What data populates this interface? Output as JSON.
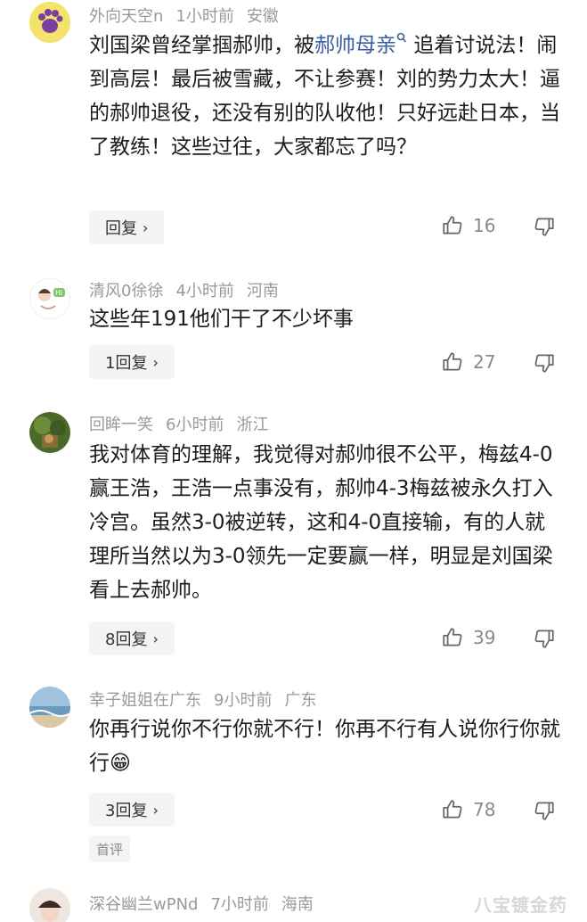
{
  "comments": [
    {
      "username": "外向天空n",
      "time": "1小时前",
      "location": "安徽",
      "text_before": "刘国梁曾经掌掴郝帅，被",
      "tag": "郝帅母亲",
      "text_after": "追着讨说法！闹到高层！最后被雪藏，不让参赛！刘的势力太大！逼的郝帅退役，还没有别的队收他！只好远赴日本，当了教练！这些过往，大家都忘了吗？",
      "reply_label": "回复",
      "likes": "16"
    },
    {
      "username": "清风0徐徐",
      "time": "4小时前",
      "location": "河南",
      "text": "这些年191他们干了不少坏事",
      "reply_label": "1回复",
      "likes": "27"
    },
    {
      "username": "回眸一笑",
      "time": "6小时前",
      "location": "浙江",
      "text": "我对体育的理解，我觉得对郝帅很不公平，梅兹4-0赢王浩，王浩一点事没有，郝帅4-3梅兹被永久打入冷宫。虽然3-0被逆转，这和4-0直接输，有的人就理所当然以为3-0领先一定要赢一样，明显是刘国梁看上去郝帅。",
      "reply_label": "8回复",
      "likes": "39"
    },
    {
      "username": "幸子姐姐在广东",
      "time": "9小时前",
      "location": "广东",
      "text": "你再行说你不行你就不行！你再不行有人说你行你就行",
      "emoji": "😁",
      "reply_label": "3回复",
      "likes": "78",
      "badge": "首评"
    },
    {
      "username": "深谷幽兰wPNd",
      "time": "7小时前",
      "location": "海南"
    }
  ],
  "watermark": "八宝镀金药",
  "icons": {
    "like": "thumbs-up-icon",
    "dislike": "thumbs-down-icon",
    "chevron": "chevron-right-icon",
    "search": "search-icon"
  },
  "colors": {
    "tag": "#3a5f9e",
    "meta": "#9a9a9a",
    "reply_bg": "#f4f4f4"
  }
}
